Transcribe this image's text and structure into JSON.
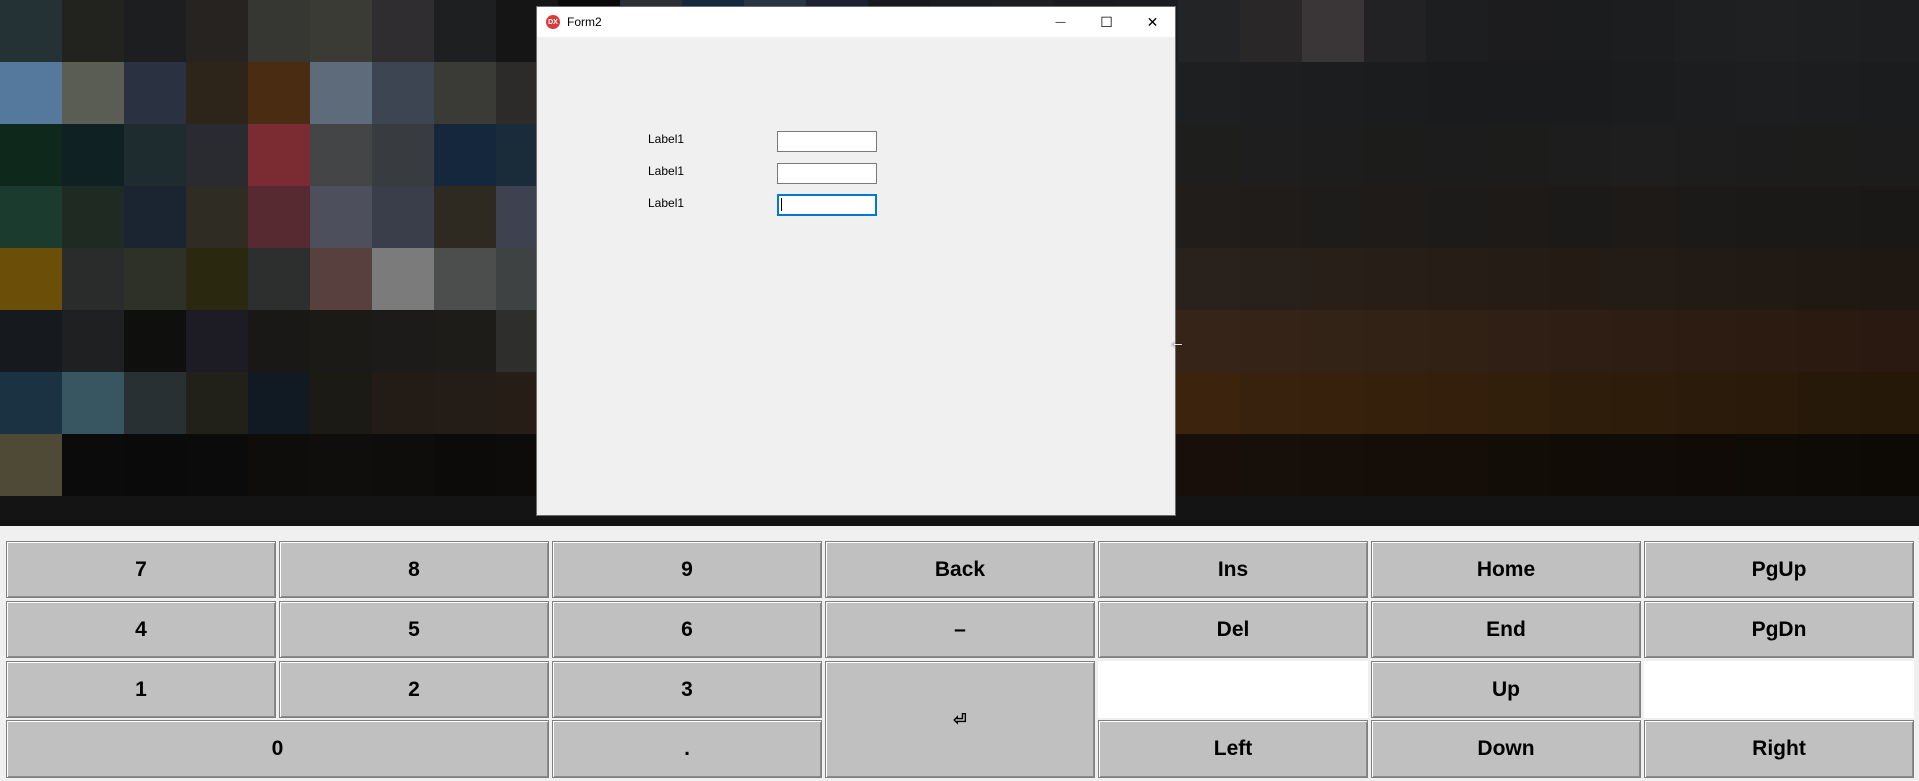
{
  "window": {
    "title": "Form2",
    "app_icon": "DX",
    "minimize_icon": "—",
    "maximize_icon": "☐",
    "close_icon": "✕"
  },
  "form": {
    "fields": [
      {
        "label": "Label1",
        "value": ""
      },
      {
        "label": "Label1",
        "value": ""
      },
      {
        "label": "Label1",
        "value": ""
      }
    ]
  },
  "keypad": {
    "row1": [
      "7",
      "8",
      "9",
      "Back",
      "Ins",
      "Home",
      "PgUp"
    ],
    "row2": [
      "4",
      "5",
      "6",
      "–",
      "Del",
      "End",
      "PgDn"
    ],
    "row3": [
      "1",
      "2",
      "3",
      "Up"
    ],
    "row4": [
      "0",
      ".",
      "Left",
      "Down",
      "Right"
    ],
    "enter": "⏎"
  },
  "cursor_icon": "⇽",
  "desktop_colors": [
    "#243236",
    "#22231f",
    "#1c1e1f",
    "#262320",
    "#363732",
    "#3b3b36",
    "#302d30",
    "#1e1f21",
    "#151515",
    "#0a0a0a",
    "#2c3036",
    "#14283e",
    "#273444",
    "#1e2134",
    "#18191c",
    "#1a1b1d",
    "#1d1e20",
    "#181a1d",
    "#1b1c1f",
    "#232425",
    "#2a2728",
    "#3a3637",
    "#222224",
    "#1d1e20",
    "#1c1c1f",
    "#1b1c1e",
    "#1c1d1f",
    "#1e1f21",
    "#1f2022",
    "#1e1f21",
    "#1d1e20",
    "#54799d",
    "#5a5d54",
    "#2a3140",
    "#2d2519",
    "#4a2c12",
    "#5d6b7a",
    "#3d4452",
    "#3a3a36",
    "#2d2b2a",
    "#101010",
    "#53575f",
    "#5b7a9b",
    "#1e2022",
    "#222326",
    "#262729",
    "#1f2123",
    "#24292b",
    "#202123",
    "#1f2022",
    "#1e1f21",
    "#1d1e20",
    "#1c1d1f",
    "#1b1c1e",
    "#1a1b1d",
    "#1a1b1d",
    "#1a1b1d",
    "#1b1c1e",
    "#1c1d1f",
    "#1d1e20",
    "#1c1d1f",
    "#1b1c1e",
    "#0e291c",
    "#0f2122",
    "#1f2c2f",
    "#2a2b30",
    "#7a2c32",
    "#444546",
    "#383c40",
    "#15273c",
    "#1a2b3a",
    "#121212",
    "#262626",
    "#1d1e1d",
    "#1f2020",
    "#202120",
    "#1f201f",
    "#212221",
    "#1f201f",
    "#1f1f1e",
    "#1e1f1e",
    "#1e1e1d",
    "#1d1e1d",
    "#1c1d1c",
    "#1c1c1b",
    "#1b1c1b",
    "#1c1c1b",
    "#1c1d1c",
    "#1d1e1d",
    "#1c1d1c",
    "#1b1c1b",
    "#1c1c1b",
    "#1b1c1b",
    "#1b3b2e",
    "#1f2a23",
    "#1b2431",
    "#2f2c24",
    "#572a31",
    "#4d505c",
    "#3a3e4b",
    "#2e2a22",
    "#3d4150",
    "#121212",
    "#2d2826",
    "#2a2725",
    "#232120",
    "#221f1e",
    "#231f1d",
    "#242120",
    "#211f1d",
    "#201e1c",
    "#211e1c",
    "#201d1b",
    "#1f1c1a",
    "#1e1c1a",
    "#1e1b19",
    "#1d1b19",
    "#1d1a18",
    "#1c1a18",
    "#1d1a18",
    "#1c1a18",
    "#1b1917",
    "#1b1917",
    "#1a1816",
    "#6b4e08",
    "#2a2b2b",
    "#2d3127",
    "#2a2910",
    "#2d2e2e",
    "#58403e",
    "#7b7b7b",
    "#4c4e4d",
    "#3f4242",
    "#121212",
    "#35302c",
    "#2d2723",
    "#2a2522",
    "#2c2520",
    "#2e2721",
    "#2e2620",
    "#2c241e",
    "#2b231d",
    "#2a221c",
    "#29211b",
    "#28201a",
    "#281f19",
    "#271e18",
    "#261d17",
    "#251c16",
    "#241b15",
    "#231b15",
    "#221a14",
    "#211913",
    "#201812",
    "#1f1711",
    "#161a1f",
    "#1f2021",
    "#0f0f0d",
    "#1d1b24",
    "#1a1816",
    "#1b1a17",
    "#1c1b19",
    "#1d1c19",
    "#2e2f2c",
    "#121212",
    "#3b2a1f",
    "#3d2a1c",
    "#3a291b",
    "#3b2a1b",
    "#3c2b1b",
    "#3a291a",
    "#382719",
    "#372619",
    "#362518",
    "#352417",
    "#342316",
    "#332216",
    "#322115",
    "#312014",
    "#301f14",
    "#2f1e13",
    "#2e1d12",
    "#2d1c12",
    "#2c1b11",
    "#2b1a10",
    "#2a1910",
    "#1b3243",
    "#385662",
    "#283034",
    "#212019",
    "#111a22",
    "#1c1a15",
    "#221b16",
    "#241c16",
    "#251d16",
    "#121212",
    "#4a2b15",
    "#4d2d14",
    "#4a2c14",
    "#472a13",
    "#452912",
    "#432811",
    "#412610",
    "#3f250f",
    "#3d240f",
    "#3b230e",
    "#39220d",
    "#37210d",
    "#35200c",
    "#331f0c",
    "#311e0b",
    "#2f1d0b",
    "#2d1c0a",
    "#2b1b0a",
    "#291a09",
    "#271909",
    "#251808",
    "#4e4a36",
    "#0b0b0b",
    "#0a0a0a",
    "#0b0b0b",
    "#0e0d0c",
    "#100e0c",
    "#0f0d0b",
    "#0c0b0a",
    "#0d0c0b",
    "#101010",
    "#1c120c",
    "#21150e",
    "#1f140d",
    "#1e130c",
    "#1d120c",
    "#1c120b",
    "#23140f",
    "#1a110b",
    "#19100a",
    "#180f0a",
    "#170f09",
    "#160e09",
    "#150e08",
    "#140d08",
    "#130d08",
    "#120c07",
    "#110c07",
    "#100b07",
    "#0f0b06",
    "#0e0a06",
    "#0d0a06"
  ]
}
